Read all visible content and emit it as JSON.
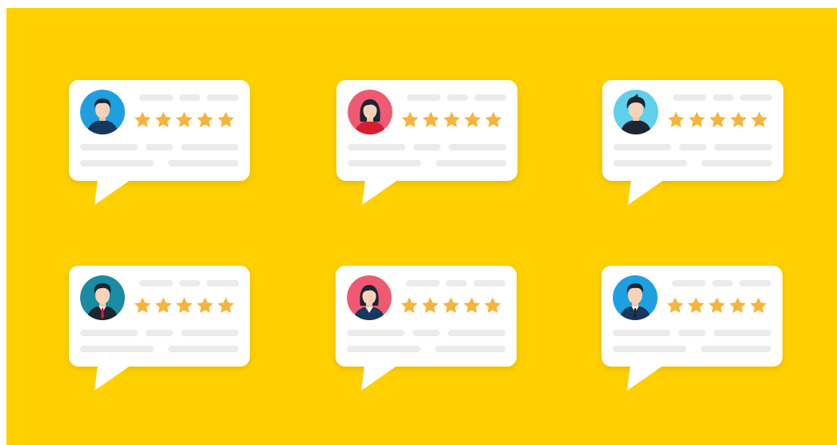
{
  "colors": {
    "background": "#ffd000",
    "card": "#ffffff",
    "placeholder_bar": "#ebebeb",
    "star": "#f5b43c"
  },
  "reviews": [
    {
      "avatar": "male-user-icon",
      "avatar_bg": "#1e9fe0",
      "rating": 5
    },
    {
      "avatar": "female-user-icon",
      "avatar_bg": "#ef5a72",
      "rating": 5
    },
    {
      "avatar": "male-user-icon",
      "avatar_bg": "#5fd0ec",
      "rating": 5
    },
    {
      "avatar": "businessman-user-icon",
      "avatar_bg": "#1b8aa3",
      "rating": 5
    },
    {
      "avatar": "businesswoman-user-icon",
      "avatar_bg": "#ef5a72",
      "rating": 5
    },
    {
      "avatar": "businessman-user-icon",
      "avatar_bg": "#1e9fe0",
      "rating": 5
    }
  ]
}
